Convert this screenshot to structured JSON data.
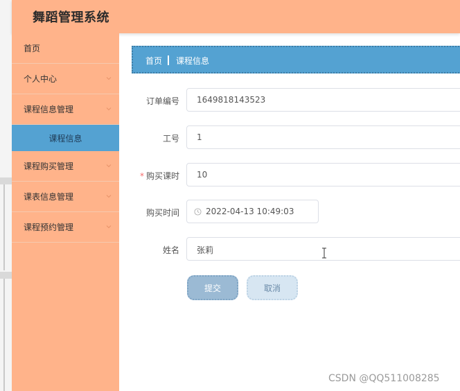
{
  "app": {
    "title": "舞蹈管理系统"
  },
  "sidebar": {
    "items": [
      {
        "label": "首页",
        "has_arrow": false
      },
      {
        "label": "个人中心",
        "has_arrow": true
      },
      {
        "label": "课程信息管理",
        "has_arrow": true
      },
      {
        "label": "课程购买管理",
        "has_arrow": true
      },
      {
        "label": "课表信息管理",
        "has_arrow": true
      },
      {
        "label": "课程预约管理",
        "has_arrow": true
      }
    ],
    "active_sub": {
      "label": "课程信息"
    }
  },
  "breadcrumb": {
    "home": "首页",
    "current": "课程信息"
  },
  "form": {
    "order_no": {
      "label": "订单编号",
      "value": "1649818143523"
    },
    "staff_no": {
      "label": "工号",
      "value": "1"
    },
    "hours": {
      "label": "购买课时",
      "required_mark": "*",
      "value": "10"
    },
    "time": {
      "label": "购买时间",
      "value": "2022-04-13 10:49:03",
      "icon": "clock-icon"
    },
    "name": {
      "label": "姓名",
      "value": "张莉"
    }
  },
  "buttons": {
    "submit": "提交",
    "cancel": "取消"
  },
  "watermark": "CSDN @QQ511008285",
  "colors": {
    "header": "#ffb38a",
    "sidebar": "#ffb38a",
    "accent": "#54a2d2",
    "submit": "#9bbad4",
    "cancel": "#d7e6f2"
  }
}
